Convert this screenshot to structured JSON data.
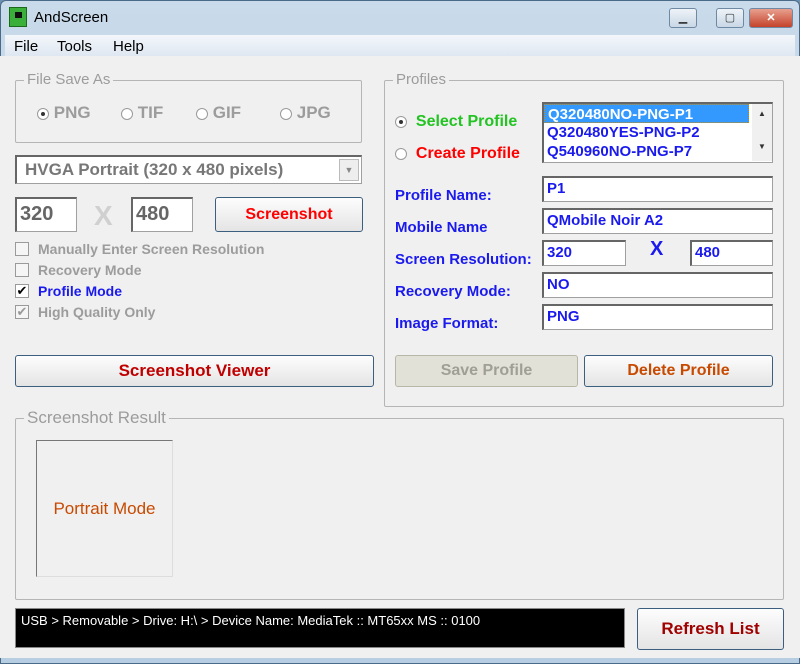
{
  "window": {
    "title": "AndScreen",
    "minimize": "▁",
    "maximize": "▢",
    "close": "✕"
  },
  "menu": [
    "File",
    "Tools",
    "Help"
  ],
  "file_save_as": {
    "label": "File Save As",
    "options": [
      "PNG",
      "TIF",
      "GIF",
      "JPG"
    ],
    "selected": "PNG"
  },
  "resolution_combo": {
    "value": "HVGA Portrait (320 x 480 pixels)"
  },
  "width": "320",
  "x": "X",
  "height": "480",
  "screenshot_button": "Screenshot",
  "checkboxes": [
    {
      "label": "Manually Enter Screen Resolution",
      "checked": false,
      "enabled": false
    },
    {
      "label": "Recovery Mode",
      "checked": false,
      "enabled": false
    },
    {
      "label": "Profile Mode",
      "checked": true,
      "enabled": true
    },
    {
      "label": "High Quality Only",
      "checked": true,
      "enabled": false
    }
  ],
  "screenshot_viewer_button": "Screenshot Viewer",
  "profiles": {
    "label": "Profiles",
    "select_profile": "Select Profile",
    "create_profile": "Create Profile",
    "list": [
      "Q320480NO-PNG-P1",
      "Q320480YES-PNG-P2",
      "Q540960NO-PNG-P7"
    ],
    "selected_index": 0,
    "profile_name_label": "Profile Name:",
    "profile_name": "P1",
    "mobile_name_label": "Mobile Name",
    "mobile_name": "QMobile Noir A2",
    "resolution_label": "Screen Resolution:",
    "res_w": "320",
    "res_x": "X",
    "res_h": "480",
    "recovery_label": "Recovery Mode:",
    "recovery": "NO",
    "format_label": "Image Format:",
    "format": "PNG",
    "save_button": "Save Profile",
    "delete_button": "Delete Profile"
  },
  "result": {
    "label": "Screenshot Result",
    "preview": "Portrait Mode"
  },
  "status": "USB > Removable >  Drive: H:\\ >  Device Name: MediaTek :: MT65xx MS :: 0100",
  "refresh_button": "Refresh List",
  "colors": {
    "green": "#22c322",
    "red": "#ff0000",
    "blue": "#1a1aee",
    "dark_red": "#c00000",
    "orange": "#c84a00"
  }
}
